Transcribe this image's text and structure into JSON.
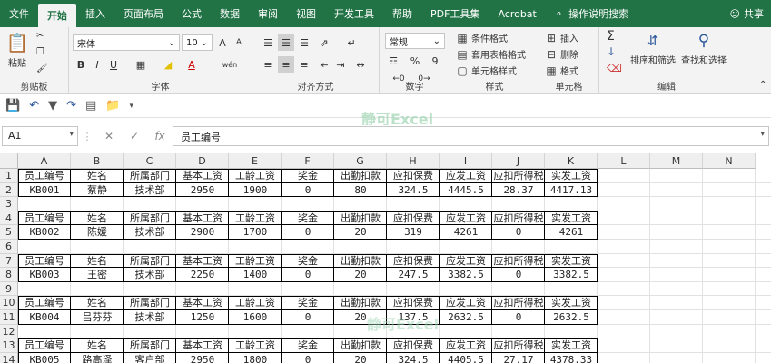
{
  "tabs": [
    "文件",
    "开始",
    "插入",
    "页面布局",
    "公式",
    "数据",
    "审阅",
    "视图",
    "开发工具",
    "帮助",
    "PDF工具集",
    "Acrobat"
  ],
  "active_tab": "开始",
  "tell_me": "操作说明搜索",
  "share": "共享",
  "ribbon": {
    "clipboard": {
      "label": "剪贴板",
      "paste": "粘贴"
    },
    "font": {
      "label": "字体",
      "name": "宋体",
      "size": "10",
      "bold": "B",
      "italic": "I",
      "underline": "U",
      "grow": "A",
      "shrink": "A",
      "wen": "wén"
    },
    "align": {
      "label": "对齐方式"
    },
    "number": {
      "label": "数字",
      "format": "常规",
      "percent": "%",
      "comma": "9"
    },
    "styles": {
      "label": "样式",
      "cond": "条件格式",
      "table": "套用表格格式",
      "cell": "单元格样式"
    },
    "cells": {
      "label": "单元格",
      "insert": "插入",
      "delete": "删除",
      "format": "格式"
    },
    "editing": {
      "label": "编辑",
      "sort": "排序和筛选",
      "find": "查找和选择"
    }
  },
  "watermark": "静可Excel",
  "watermark2": "静可Excel",
  "formula_bar": {
    "name_box": "A1",
    "fx": "fx",
    "value": "员工编号"
  },
  "columns": [
    "A",
    "B",
    "C",
    "D",
    "E",
    "F",
    "G",
    "H",
    "I",
    "J",
    "K",
    "L",
    "M",
    "N"
  ],
  "rows": [
    "1",
    "2",
    "3",
    "4",
    "5",
    "6",
    "7",
    "8",
    "9",
    "10",
    "11",
    "12",
    "13",
    "14"
  ],
  "headers": [
    "员工编号",
    "姓名",
    "所属部门",
    "基本工资",
    "工龄工资",
    "奖金",
    "出勤扣款",
    "应扣保费",
    "应发工资",
    "应扣所得税",
    "实发工资"
  ],
  "records": [
    [
      "KB001",
      "蔡静",
      "技术部",
      "2950",
      "1900",
      "0",
      "80",
      "324.5",
      "4445.5",
      "28.37",
      "4417.13"
    ],
    [
      "KB002",
      "陈媛",
      "技术部",
      "2900",
      "1700",
      "0",
      "20",
      "319",
      "4261",
      "0",
      "4261"
    ],
    [
      "KB003",
      "王密",
      "技术部",
      "2250",
      "1400",
      "0",
      "20",
      "247.5",
      "3382.5",
      "0",
      "3382.5"
    ],
    [
      "KB004",
      "吕芬芬",
      "技术部",
      "1250",
      "1600",
      "0",
      "20",
      "137.5",
      "2632.5",
      "0",
      "2632.5"
    ],
    [
      "KB005",
      "路高泽",
      "客户部",
      "2950",
      "1800",
      "0",
      "20",
      "324.5",
      "4405.5",
      "27.17",
      "4378.33"
    ]
  ]
}
